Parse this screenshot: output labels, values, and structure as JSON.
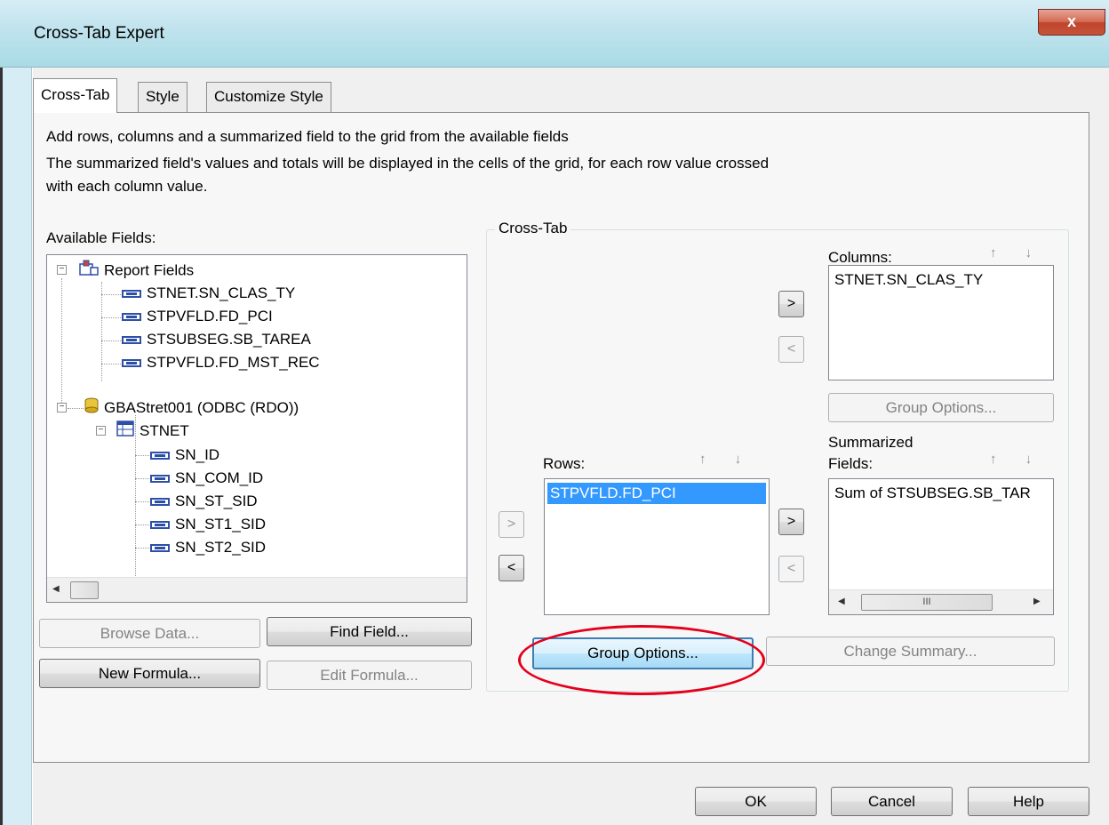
{
  "window": {
    "title": "Cross-Tab Expert",
    "close_label": "x"
  },
  "tabs": [
    {
      "label": "Cross-Tab",
      "active": true
    },
    {
      "label": "Style",
      "active": false
    },
    {
      "label": "Customize Style",
      "active": false
    }
  ],
  "description": {
    "line1": "Add rows, columns and a summarized field to the grid from the available fields",
    "line2": "The summarized field's values and totals will be displayed in the cells of the grid, for each row value crossed",
    "line3": "with each column value."
  },
  "available_fields": {
    "label": "Available Fields:",
    "tree": [
      {
        "label": "Report Fields",
        "icon": "report-fields-icon"
      },
      {
        "label": "STNET.SN_CLAS_TY",
        "icon": "field-icon"
      },
      {
        "label": "STPVFLD.FD_PCI",
        "icon": "field-icon"
      },
      {
        "label": "STSUBSEG.SB_TAREA",
        "icon": "field-icon"
      },
      {
        "label": "STPVFLD.FD_MST_REC",
        "icon": "field-icon"
      },
      {
        "label": "GBAStret001 (ODBC (RDO))",
        "icon": "database-icon"
      },
      {
        "label": "STNET",
        "icon": "table-icon"
      },
      {
        "label": "SN_ID",
        "icon": "field-icon"
      },
      {
        "label": "SN_COM_ID",
        "icon": "field-icon"
      },
      {
        "label": "SN_ST_SID",
        "icon": "field-icon"
      },
      {
        "label": "SN_ST1_SID",
        "icon": "field-icon"
      },
      {
        "label": "SN_ST2_SID",
        "icon": "field-icon"
      }
    ],
    "browse_data_label": "Browse Data...",
    "find_field_label": "Find Field...",
    "new_formula_label": "New Formula...",
    "edit_formula_label": "Edit Formula..."
  },
  "crosstab": {
    "group_title": "Cross-Tab",
    "columns_label": "Columns:",
    "columns_items": [
      "STNET.SN_CLAS_TY"
    ],
    "rows_label": "Rows:",
    "rows_items": [
      "STPVFLD.FD_PCI"
    ],
    "summarized_label_1": "Summarized",
    "summarized_label_2": "Fields:",
    "summarized_items": [
      "Sum of STSUBSEG.SB_TAR"
    ],
    "add_label": ">",
    "remove_label": "<",
    "up_down": "↑ ↓",
    "columns_group_options_label": "Group Options...",
    "rows_group_options_label": "Group Options...",
    "change_summary_label": "Change Summary...",
    "hscroll_thumb_label": "III"
  },
  "footer": {
    "ok_label": "OK",
    "cancel_label": "Cancel",
    "help_label": "Help"
  },
  "annotation": {
    "highlight_color": "#e3001b"
  }
}
